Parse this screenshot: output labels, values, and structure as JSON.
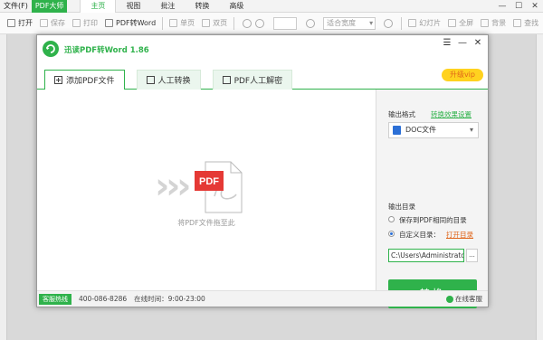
{
  "host": {
    "file_menu": "文件(F)",
    "brand": "PDF大师",
    "menus": [
      "主页",
      "视图",
      "批注",
      "转换",
      "高级"
    ],
    "toolbar": {
      "open": "打开",
      "save": "保存",
      "print": "打印",
      "pdf_to_word": "PDF转Word",
      "single_page": "单页",
      "double_page": "双页",
      "zoom_value": "适合宽度",
      "slideshow": "幻灯片",
      "fullscreen": "全屏",
      "background": "背景",
      "find": "查找"
    }
  },
  "dialog": {
    "title": "迅读PDF转Word 1.86",
    "controls": {
      "menu": "☰",
      "minimize": "—",
      "close": "✕"
    },
    "tabs": [
      "添加PDF文件",
      "人工转换",
      "PDF人工解密"
    ],
    "vip_button": "升级vip",
    "drop_hint": "将PDF文件拖至此",
    "pdf_badge": "PDF",
    "panel": {
      "format_label": "输出格式",
      "effect_link": "转换效果设置",
      "format_value": "DOC文件",
      "dir_label": "输出目录",
      "opt_same": "保存到PDF相同的目录",
      "opt_custom": "自定义目录：",
      "open_dir": "打开目录",
      "path_value": "C:\\Users\\Administrator",
      "browse": "...",
      "convert": "转换"
    },
    "footer": {
      "hotline_label": "客服热线",
      "phone": "400-086-8286",
      "hours": "在线时间：9:00-23:00",
      "online_service": "在线客服"
    }
  },
  "colors": {
    "accent": "#2fb24b",
    "vip": "#ffd21f",
    "pdf_red": "#e53935",
    "link_orange": "#e0651a"
  }
}
